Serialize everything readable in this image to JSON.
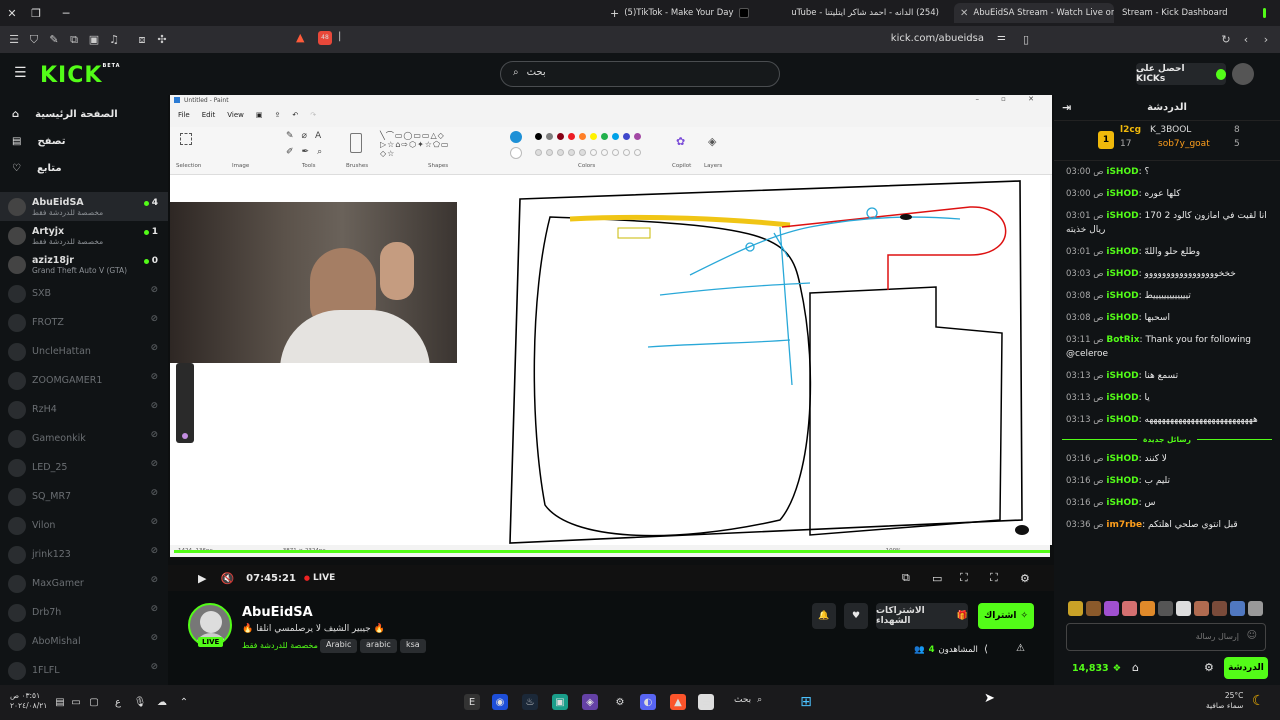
{
  "browser": {
    "tabs": [
      {
        "label": "(5)TikTok - Make Your Day"
      },
      {
        "label": "(254) الدانه - احمد شاكر ايتليتنا - YouTube"
      },
      {
        "label": "AbuEidSA Stream - Watch Live on Kick"
      },
      {
        "label": "Stream - Kick Dashboard"
      }
    ],
    "url": "kick.com/abueidsa",
    "brave_badge": "48"
  },
  "header": {
    "logo": "KICK",
    "logo_beta": "BETA",
    "search_placeholder": "بحث",
    "get_kicks": "احصل على KICKs"
  },
  "sidebar": {
    "nav": [
      {
        "label": "الصفحة الرئيسية"
      },
      {
        "label": "تصفح"
      },
      {
        "label": "متابع"
      }
    ],
    "channels": [
      {
        "name": "AbuEidSA",
        "sub": "مخصصة للدردشة فقط",
        "count": "4",
        "live": true
      },
      {
        "name": "Artyjx",
        "sub": "مخصصة للدردشة فقط",
        "count": "1",
        "live": true
      },
      {
        "name": "aziz18jr",
        "sub": "Grand Theft Auto V (GTA)",
        "count": "0",
        "live": true
      },
      {
        "name": "SXB",
        "live": false
      },
      {
        "name": "FROTZ",
        "live": false
      },
      {
        "name": "UncleHattan",
        "live": false
      },
      {
        "name": "ZOOMGAMER1",
        "live": false
      },
      {
        "name": "RzH4",
        "live": false
      },
      {
        "name": "Gameonkik",
        "live": false
      },
      {
        "name": "LED_25",
        "live": false
      },
      {
        "name": "SQ_MR7",
        "live": false
      },
      {
        "name": "Vilon",
        "live": false
      },
      {
        "name": "jrink123",
        "live": false
      },
      {
        "name": "MaxGamer",
        "live": false
      },
      {
        "name": "Drb7h",
        "live": false
      },
      {
        "name": "AboMishal",
        "live": false
      },
      {
        "name": "1FLFL",
        "live": false
      }
    ]
  },
  "paint": {
    "window_title": "Untitled - Paint",
    "menu": [
      "File",
      "Edit",
      "View"
    ],
    "groups": [
      "Selection",
      "Image",
      "Tools",
      "Brushes",
      "Shapes",
      "Colors",
      "Copilot",
      "Layers"
    ],
    "status_pos": "1424, 136px",
    "status_size": "3871 × 2324px",
    "zoom": "100%"
  },
  "player": {
    "time": "07:45:21",
    "live_label": "LIVE"
  },
  "stream": {
    "name": "AbuEidSA",
    "title": "🔥 جيبير الشيف لا يرصلمسي انلقا 🔥",
    "category": "مخصصة للدردشة فقط",
    "tags": [
      "Arabic",
      "arabic",
      "ksa"
    ],
    "live_badge": "LIVE",
    "subscribe": "اشتراك",
    "gift_subs": "الاشتراكات الشهداء",
    "viewers_label": "المشاهدون",
    "viewers": "4"
  },
  "chat": {
    "title": "الدردشة",
    "leaders": [
      {
        "name": "l2cg",
        "value": "8",
        "name2": "K_3BOOL"
      },
      {
        "name": "",
        "value": "17",
        "name2": "sob7y_goat",
        "value2": "5"
      }
    ],
    "messages": [
      {
        "time": "03:00 ص",
        "user": "iSHOD",
        "text": "؟"
      },
      {
        "time": "03:00 ص",
        "user": "iSHOD",
        "text": "كلها عوره"
      },
      {
        "time": "03:01 ص",
        "user": "iSHOD",
        "text": "انا لقيت في امازون كالود 2 170 ريال خذيته"
      },
      {
        "time": "03:01 ص",
        "user": "iSHOD",
        "text": "وطلع حلو واللهّ"
      },
      {
        "time": "03:03 ص",
        "user": "iSHOD",
        "text": "خخخووووووووووووووووو"
      },
      {
        "time": "03:08 ص",
        "user": "iSHOD",
        "text": "تيييييييييييييط"
      },
      {
        "time": "03:08 ص",
        "user": "iSHOD",
        "text": "اسحبها"
      },
      {
        "time": "03:11 ص",
        "user": "BotRix",
        "text": "Thank you for following @celeroe"
      },
      {
        "time": "03:13 ص",
        "user": "iSHOD",
        "text": "تسمع هنا"
      },
      {
        "time": "03:13 ص",
        "user": "iSHOD",
        "text": "يا"
      },
      {
        "time": "03:13 ص",
        "user": "iSHOD",
        "text": "ههههههههههههههههههههههههههه"
      }
    ],
    "new_messages": "رسائل جديدة",
    "messages2": [
      {
        "time": "03:16 ص",
        "user": "iSHOD",
        "text": "لا كنند"
      },
      {
        "time": "03:16 ص",
        "user": "iSHOD",
        "text": "تليم ب"
      },
      {
        "time": "03:16 ص",
        "user": "iSHOD",
        "text": "س"
      },
      {
        "time": "03:36 ص",
        "user": "im7rbe",
        "text": "قبل انتوي صلحي اهلتكم"
      }
    ],
    "input_placeholder": "إرسال رسالة",
    "points": "14,833",
    "send": "الدردشة"
  },
  "taskbar": {
    "search": "بحث",
    "clock": "٠٣:٥١ ص",
    "date": "٢٠٢٤/٠٨/٢١",
    "weather_temp": "25°C",
    "weather_text": "سماء صافية",
    "lang": "ع"
  }
}
